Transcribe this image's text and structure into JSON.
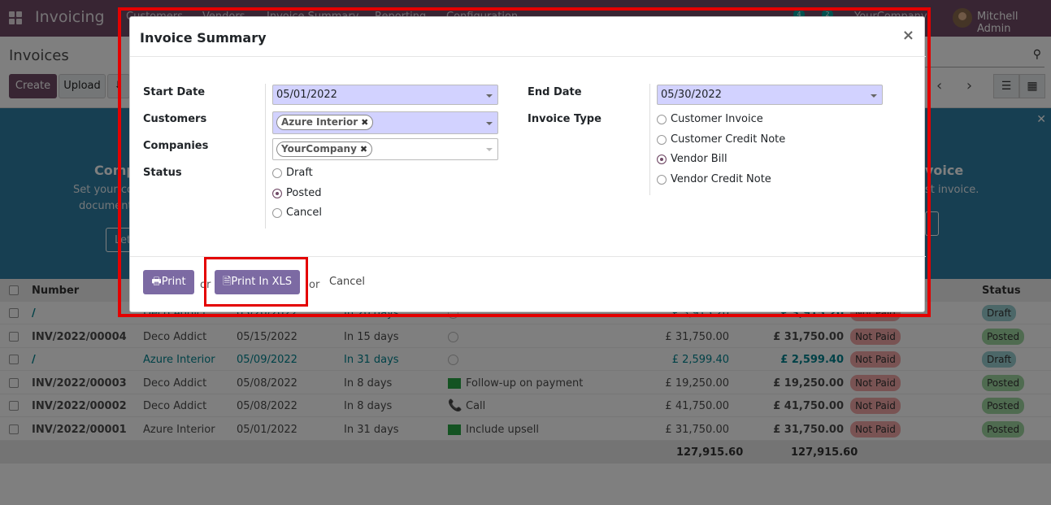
{
  "navbar": {
    "app_name": "Invoicing",
    "menu": [
      "Customers",
      "Vendors",
      "Invoice Summary",
      "Reporting",
      "Configuration"
    ],
    "messages_count": "4",
    "activities_count": "2",
    "company": "YourCompany",
    "user": "Mitchell Admin"
  },
  "control_panel": {
    "title": "Invoices",
    "create_label": "Create",
    "upload_label": "Upload"
  },
  "helper": {
    "title_left": "Comp",
    "text_left_1": "Set your co",
    "text_left_2": "documents",
    "btn_left": "Let",
    "title_right": "voice",
    "text_right": "st invoice.",
    "btn_right": "e"
  },
  "list": {
    "columns": [
      "Number",
      "Status"
    ],
    "rows": [
      {
        "number": "/",
        "partner": "Deco Addict",
        "date": "05/20/2022",
        "due": "In 20 days",
        "activity": "",
        "untaxed": "£ 3,915.20",
        "total": "£ 3,915.20",
        "payment": "Not Paid",
        "status": "Draft",
        "link": true
      },
      {
        "number": "INV/2022/00004",
        "partner": "Deco Addict",
        "date": "05/15/2022",
        "due": "In 15 days",
        "activity": "",
        "untaxed": "£ 31,750.00",
        "total": "£ 31,750.00",
        "payment": "Not Paid",
        "status": "Posted",
        "link": false
      },
      {
        "number": "/",
        "partner": "Azure Interior",
        "date": "05/09/2022",
        "due": "In 31 days",
        "activity": "",
        "untaxed": "£ 2,599.40",
        "total": "£ 2,599.40",
        "payment": "Not Paid",
        "status": "Draft",
        "link": true
      },
      {
        "number": "INV/2022/00003",
        "partner": "Deco Addict",
        "date": "05/08/2022",
        "due": "In 8 days",
        "activity": "Follow-up on payment",
        "untaxed": "£ 19,250.00",
        "total": "£ 19,250.00",
        "payment": "Not Paid",
        "status": "Posted",
        "link": false
      },
      {
        "number": "INV/2022/00002",
        "partner": "Deco Addict",
        "date": "05/08/2022",
        "due": "In 8 days",
        "activity": "Call",
        "untaxed": "£ 41,750.00",
        "total": "£ 41,750.00",
        "payment": "Not Paid",
        "status": "Posted",
        "link": false
      },
      {
        "number": "INV/2022/00001",
        "partner": "Azure Interior",
        "date": "05/01/2022",
        "due": "In 31 days",
        "activity": "Include upsell",
        "untaxed": "£ 31,750.00",
        "total": "£ 31,750.00",
        "payment": "Not Paid",
        "status": "Posted",
        "link": false
      }
    ],
    "total_untaxed": "127,915.60",
    "total_total": "127,915.60"
  },
  "dialog": {
    "title": "Invoice Summary",
    "close_glyph": "×",
    "labels": {
      "start_date": "Start Date",
      "customers": "Customers",
      "companies": "Companies",
      "status": "Status",
      "end_date": "End Date",
      "invoice_type": "Invoice Type"
    },
    "start_date_value": "05/01/2022",
    "end_date_value": "05/30/2022",
    "customers_tag": "Azure Interior",
    "companies_tag": "YourCompany",
    "status_options": [
      {
        "label": "Draft",
        "selected": false
      },
      {
        "label": "Posted",
        "selected": true
      },
      {
        "label": "Cancel",
        "selected": false
      }
    ],
    "invoice_type_options": [
      {
        "label": "Customer Invoice",
        "selected": false
      },
      {
        "label": "Customer Credit Note",
        "selected": false
      },
      {
        "label": "Vendor Bill",
        "selected": true
      },
      {
        "label": "Vendor Credit Note",
        "selected": false
      }
    ],
    "print_label": "Print",
    "print_xls_label": "Print In XLS",
    "or_label": "or",
    "cancel_label": "Cancel"
  },
  "colors": {
    "brand": "#714b67",
    "button": "#7c6aa3",
    "required_field": "#d2d2ff",
    "highlight": "#e40000"
  }
}
